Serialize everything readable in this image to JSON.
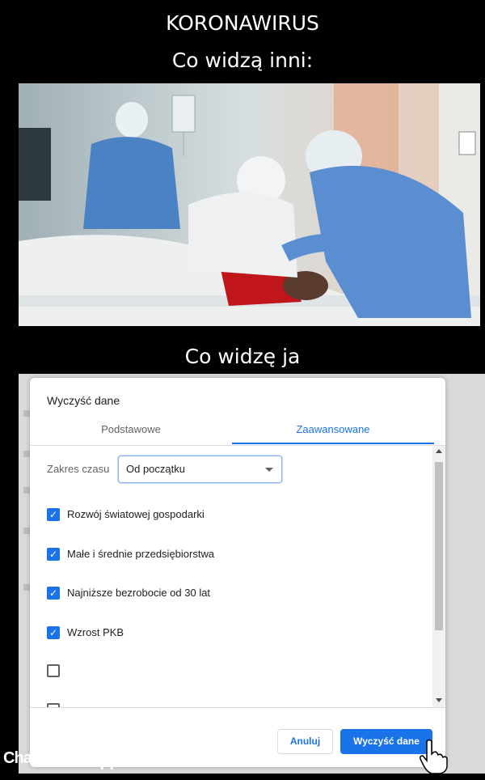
{
  "captions": {
    "title": "KORONAWIRUS",
    "others": "Co widzą inni:",
    "me": "Co widzę ja"
  },
  "dialog": {
    "title": "Wyczyść dane",
    "tabs": [
      {
        "label": "Podstawowe",
        "active": false
      },
      {
        "label": "Zaawansowane",
        "active": true
      }
    ],
    "time_range": {
      "label": "Zakres czasu",
      "value": "Od początku"
    },
    "items": [
      {
        "label": "Rozwój światowej gospodarki",
        "checked": true
      },
      {
        "label": "Małe i średnie przedsiębiorstwa",
        "checked": true
      },
      {
        "label": "Najniższe bezrobocie od 30 lat",
        "checked": true
      },
      {
        "label": "Wzrost PKB",
        "checked": true
      },
      {
        "label": "",
        "checked": false
      },
      {
        "label": "",
        "checked": false
      }
    ],
    "buttons": {
      "cancel": "Anuluj",
      "clear": "Wyczyść dane"
    },
    "accent_color": "#1a73e8"
  },
  "watermark": {
    "name": "Chamsko",
    "suffix": ".pl"
  }
}
